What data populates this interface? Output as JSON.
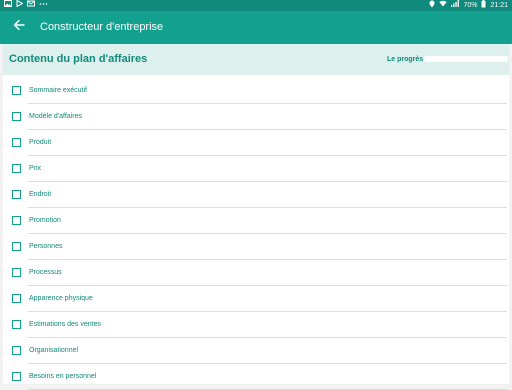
{
  "status_bar": {
    "battery": "70%",
    "time": "21:21",
    "icons": [
      "image-icon",
      "play-store-icon",
      "mail-icon",
      "more-icon",
      "location-icon",
      "wifi-icon",
      "signal-icon",
      "battery-icon"
    ]
  },
  "app_bar": {
    "title": "Constructeur d'entreprise",
    "back_icon": "arrow-left-icon"
  },
  "panel": {
    "title": "Contenu du plan d'affaires",
    "progress_label": "Le progrès",
    "progress_value": 0
  },
  "items": [
    {
      "label": "Sommaire exécutif",
      "checked": false
    },
    {
      "label": "Modèle d'affaires",
      "checked": false
    },
    {
      "label": "Produit",
      "checked": false
    },
    {
      "label": "Prix",
      "checked": false
    },
    {
      "label": "Endroit",
      "checked": false
    },
    {
      "label": "Promotion",
      "checked": false
    },
    {
      "label": "Personnes",
      "checked": false
    },
    {
      "label": "Processus",
      "checked": false
    },
    {
      "label": "Apparence physique",
      "checked": false
    },
    {
      "label": "Estimations des ventes",
      "checked": false
    },
    {
      "label": "Organisationnel",
      "checked": false
    },
    {
      "label": "Besoins en personnel",
      "checked": false
    }
  ],
  "colors": {
    "primary": "#12a08f",
    "primary_dark": "#0f8a7c",
    "header_bg": "#ddf0ee",
    "text_accent": "#108a7b"
  }
}
